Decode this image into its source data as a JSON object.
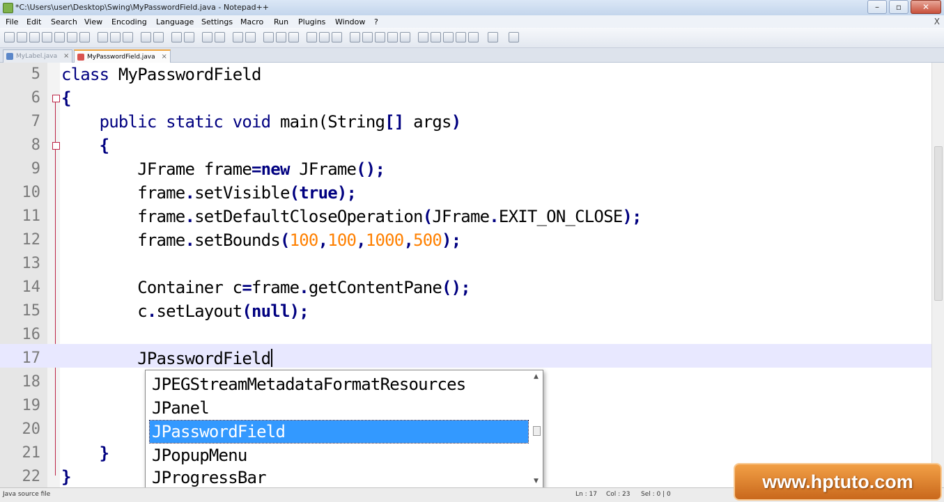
{
  "window": {
    "title": "*C:\\Users\\user\\Desktop\\Swing\\MyPasswordField.java - Notepad++",
    "min": "–",
    "max": "▫",
    "close": "✕"
  },
  "menu": [
    "File",
    "Edit",
    "Search",
    "View",
    "Encoding",
    "Language",
    "Settings",
    "Macro",
    "Run",
    "Plugins",
    "Window",
    "?"
  ],
  "menu_close": "X",
  "tabs": [
    {
      "label": "MyLabel.java",
      "active": false,
      "icon_color": "#5b87c9"
    },
    {
      "label": "MyPasswordField.java",
      "active": true,
      "icon_color": "#d9534f"
    }
  ],
  "editor": {
    "current_line": 17,
    "lines": [
      {
        "n": "5",
        "code": "class MyPasswordField"
      },
      {
        "n": "6",
        "code": "{"
      },
      {
        "n": "7",
        "code": "    public static void main(String[] args)"
      },
      {
        "n": "8",
        "code": "    {"
      },
      {
        "n": "9",
        "code": "        JFrame frame=new JFrame();"
      },
      {
        "n": "10",
        "code": "        frame.setVisible(true);"
      },
      {
        "n": "11",
        "code": "        frame.setDefaultCloseOperation(JFrame.EXIT_ON_CLOSE);"
      },
      {
        "n": "12",
        "code": "        frame.setBounds(100,100,1000,500);"
      },
      {
        "n": "13",
        "code": ""
      },
      {
        "n": "14",
        "code": "        Container c=frame.getContentPane();"
      },
      {
        "n": "15",
        "code": "        c.setLayout(null);"
      },
      {
        "n": "16",
        "code": ""
      },
      {
        "n": "17",
        "code": "        JPasswordField"
      },
      {
        "n": "18",
        "code": ""
      },
      {
        "n": "19",
        "code": ""
      },
      {
        "n": "20",
        "code": ""
      },
      {
        "n": "21",
        "code": "    }"
      },
      {
        "n": "22",
        "code": "}"
      }
    ]
  },
  "autocomplete": {
    "items": [
      "JPEGStreamMetadataFormatResources",
      "JPanel",
      "JPasswordField",
      "JPopupMenu",
      "JProgressBar"
    ],
    "selected_index": 2
  },
  "status": {
    "file_type": "Java source file",
    "ln": "Ln : 17",
    "col": "Col : 23",
    "sel": "Sel : 0 | 0"
  },
  "watermark": "www.hptuto.com",
  "colors": {
    "keyword": "#000080",
    "number": "#ff8000",
    "selection": "#3399ff",
    "current_line": "#e8e8ff"
  }
}
